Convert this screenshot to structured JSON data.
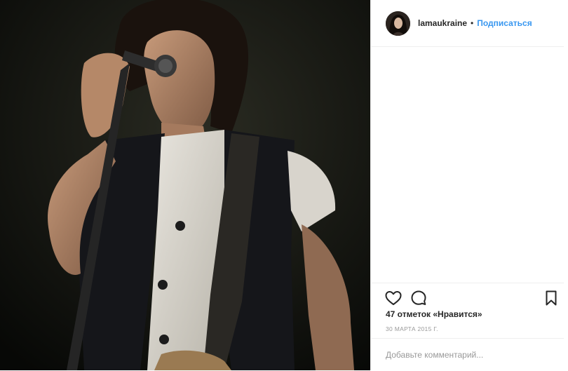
{
  "post": {
    "image_alt": "",
    "author": {
      "username": "lamaukraine",
      "separator": "•",
      "follow_label": "Подписаться"
    },
    "actions": {
      "like_icon": "heart-icon",
      "comment_icon": "comment-icon",
      "save_icon": "bookmark-icon"
    },
    "likes_text": "47 отметок «Нравится»",
    "date_text": "30 марта 2015 г.",
    "comment": {
      "placeholder": "Добавьте комментарий...",
      "value": ""
    }
  },
  "colors": {
    "link": "#3897f0",
    "text": "#262626",
    "muted": "#999999",
    "border": "#efefef"
  }
}
